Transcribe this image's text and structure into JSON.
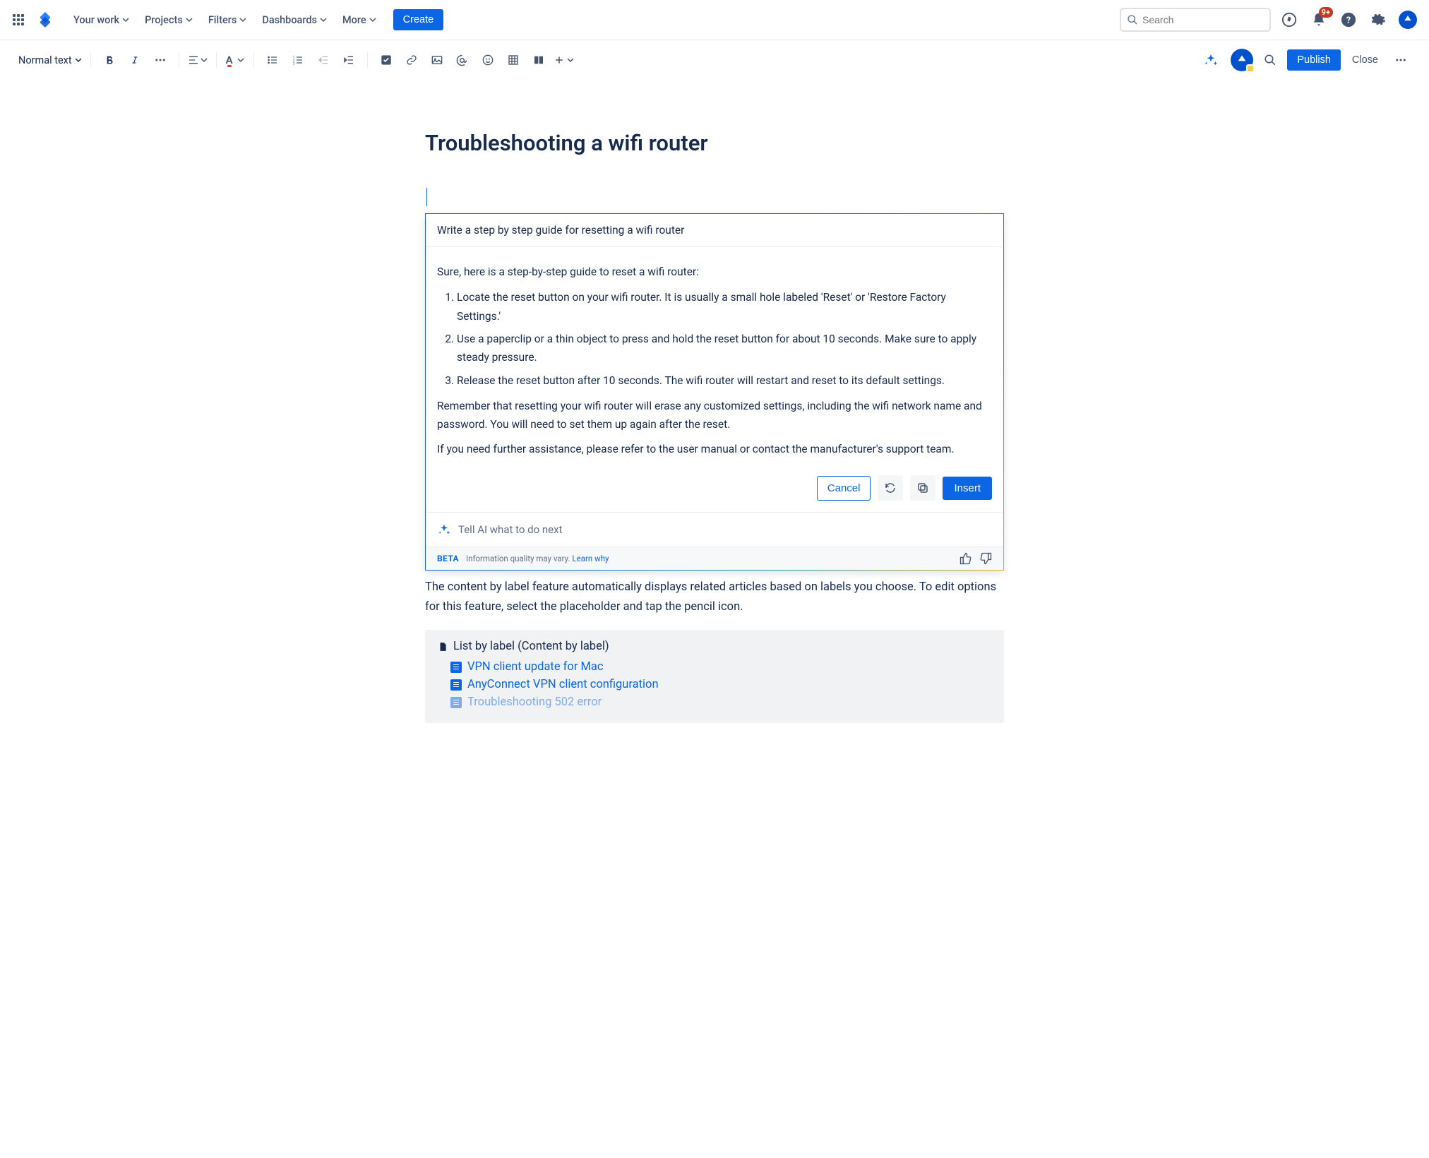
{
  "nav": {
    "items": [
      "Your work",
      "Projects",
      "Filters",
      "Dashboards",
      "More"
    ],
    "create": "Create",
    "search_placeholder": "Search",
    "badge": "9+"
  },
  "editor": {
    "text_style": "Normal text",
    "publish": "Publish",
    "close": "Close"
  },
  "page": {
    "title": "Troubleshooting a wifi router"
  },
  "ai": {
    "prompt": "Write a step by step guide for resetting a wifi router",
    "intro": "Sure, here is a step-by-step guide to reset a wifi router:",
    "steps": [
      "Locate the reset button on your wifi router. It is usually a small hole labeled 'Reset' or 'Restore Factory Settings.'",
      "Use a paperclip or a thin object to press and hold the reset button for about 10 seconds. Make sure to apply steady pressure.",
      "Release the reset button after 10 seconds. The wifi router will restart and reset to its default settings."
    ],
    "note1": "Remember that resetting your wifi router will erase any customized settings, including the wifi network name and password. You will need to set them up again after the reset.",
    "note2": "If you need further assistance, please refer to the user manual or contact the manufacturer's support team.",
    "cancel": "Cancel",
    "insert": "Insert",
    "next_placeholder": "Tell AI what to do next",
    "beta": "BETA",
    "disclaimer": "Information quality may vary.",
    "learn": "Learn why"
  },
  "body": {
    "text": "The content by label feature automatically displays related articles based on labels you choose. To edit options for this feature, select the placeholder and tap the pencil icon.",
    "label_head": "List by label (Content by label)",
    "label_items": [
      "VPN client update for Mac",
      "AnyConnect VPN client configuration",
      "Troubleshooting 502 error"
    ]
  }
}
